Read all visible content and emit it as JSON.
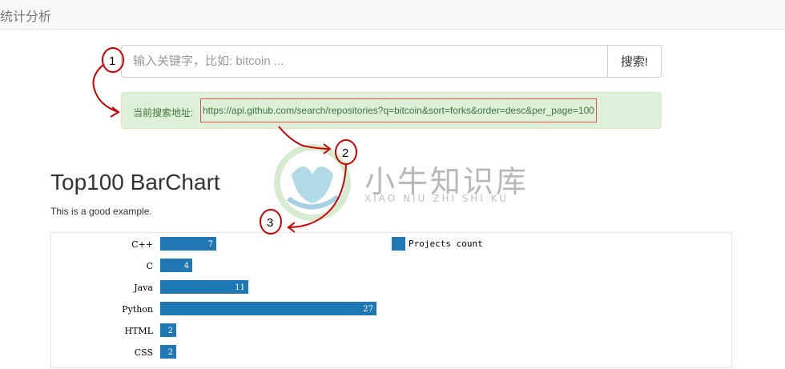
{
  "navbar": {
    "brand": "统计分析"
  },
  "search": {
    "placeholder": "输入关键字，比如: bitcoin ...",
    "value": "",
    "button_label": "搜索!"
  },
  "alert": {
    "label": "当前搜索地址:",
    "url": "https://api.github.com/search/repositories?q=bitcoin&sort=forks&order=desc&per_page=100"
  },
  "heading": {
    "title": "Top100 BarChart",
    "subtitle": "This is a good example."
  },
  "annotations": [
    "1",
    "2",
    "3"
  ],
  "watermark": {
    "title": "小牛知识库",
    "subtitle": "XIAO NIU ZHI SHI KU"
  },
  "colors": {
    "bar": "#1f77b4",
    "annotation": "#cc0000",
    "alert_bg": "#dff0d8"
  },
  "chart_data": {
    "type": "bar",
    "orientation": "horizontal",
    "categories": [
      "C++",
      "C",
      "Java",
      "Python",
      "HTML",
      "CSS"
    ],
    "series": [
      {
        "name": "Projects count",
        "values": [
          7,
          4,
          11,
          27,
          2,
          2
        ]
      }
    ],
    "legend": "top-center",
    "grid": false
  }
}
